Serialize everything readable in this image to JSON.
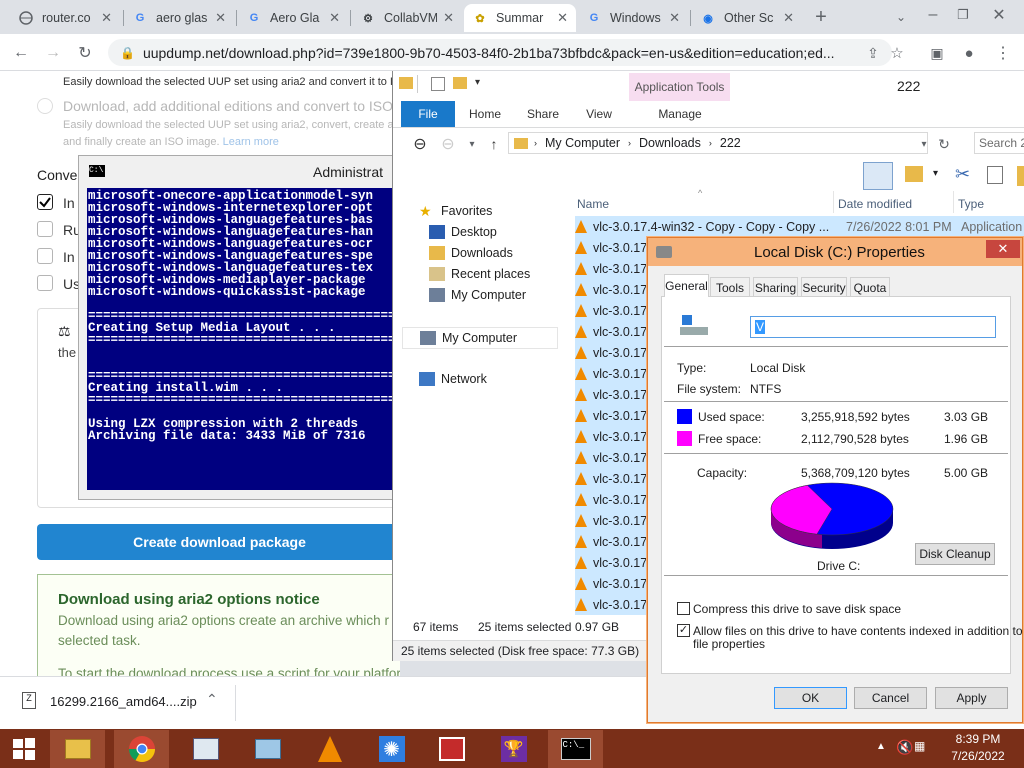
{
  "browser": {
    "tabs": [
      {
        "label": "router.co",
        "active": false
      },
      {
        "label": "aero glas",
        "active": false
      },
      {
        "label": "Aero Gla",
        "active": false
      },
      {
        "label": "CollabVM",
        "active": false
      },
      {
        "label": "Summar",
        "active": true
      },
      {
        "label": "Windows",
        "active": false
      },
      {
        "label": "Other Sc",
        "active": false
      }
    ],
    "url": "uupdump.net/download.php?id=739e1800-9b70-4503-84f0-2b1ba73bfbdc&pack=en-us&edition=education;ed..."
  },
  "page": {
    "line1": "Easily download the selected UUP set using aria2 and convert it to IS",
    "option_download_add": "Download, add additional editions and convert to ISO",
    "line2": "Easily download the selected UUP set using aria2, convert, create ad",
    "line3": "and finally create an ISO image.",
    "learn_more": "Learn more",
    "conv_heading": "Conver",
    "opt1": "In",
    "opt2": "Ru",
    "opt3": "In",
    "opt4": "Us",
    "box_text": "the",
    "create_button": "Create download package",
    "notice_title": "Download using aria2 options notice",
    "notice_line1": "Download using aria2 options create an archive which r",
    "notice_line2": "selected task.",
    "notice_line3": "To start the download process use a script for your platform:"
  },
  "cmd": {
    "title": "Administrat",
    "lines": [
      "microsoft-onecore-applicationmodel-syn",
      "microsoft-windows-internetexplorer-opt",
      "microsoft-windows-languagefeatures-bas",
      "microsoft-windows-languagefeatures-han",
      "microsoft-windows-languagefeatures-ocr",
      "microsoft-windows-languagefeatures-spe",
      "microsoft-windows-languagefeatures-tex",
      "microsoft-windows-mediaplayer-package",
      "microsoft-windows-quickassist-package",
      "",
      "===========================================",
      "Creating Setup Media Layout . . .",
      "===========================================",
      "",
      "",
      "===========================================",
      "Creating install.wim . . .",
      "===========================================",
      "",
      "Using LZX compression with 2 threads",
      "Archiving file data: 3433 MiB of 7316"
    ]
  },
  "download_bar": {
    "filename": "16299.2166_amd64....zip"
  },
  "explorer": {
    "window_title": "222",
    "contextual_tab": "Application Tools",
    "ribbon_tabs": [
      "File",
      "Home",
      "Share",
      "View",
      "Manage"
    ],
    "breadcrumb": [
      "My Computer",
      "Downloads",
      "222"
    ],
    "search_placeholder": "Search 2",
    "nav": {
      "favorites": "Favorites",
      "desktop": "Desktop",
      "downloads": "Downloads",
      "recent": "Recent places",
      "mycomputer_fav": "My Computer",
      "mycomputer": "My Computer",
      "network": "Network"
    },
    "columns": {
      "name": "Name",
      "date": "Date modified",
      "type": "Type"
    },
    "first_file": {
      "name": "vlc-3.0.17.4-win32 - Copy - Copy - Copy ...",
      "date": "7/26/2022 8:01 PM",
      "type": "Application"
    },
    "file_rows": [
      "vlc-3.0.17",
      "vlc-3.0.17",
      "vlc-3.0.17",
      "vlc-3.0.17",
      "vlc-3.0.17",
      "vlc-3.0.17",
      "vlc-3.0.17",
      "vlc-3.0.17",
      "vlc-3.0.17",
      "vlc-3.0.17",
      "vlc-3.0.17",
      "vlc-3.0.17",
      "vlc-3.0.17",
      "vlc-3.0.17",
      "vlc-3.0.17",
      "vlc-3.0.17",
      "vlc-3.0.17",
      "vlc-3.0.17"
    ],
    "item_count": "67 items",
    "selected_count": "25 items selected",
    "selected_size": "0.97 GB",
    "status_bar": "25 items selected (Disk free space: 77.3 GB)"
  },
  "props": {
    "title": "Local Disk (C:) Properties",
    "tabs": [
      "General",
      "Tools",
      "Sharing",
      "Security",
      "Quota"
    ],
    "name_value": "V",
    "type_label": "Type:",
    "type_value": "Local Disk",
    "fs_label": "File system:",
    "fs_value": "NTFS",
    "used_label": "Used space:",
    "used_bytes": "3,255,918,592 bytes",
    "used_gb": "3.03 GB",
    "free_label": "Free space:",
    "free_bytes": "2,112,790,528 bytes",
    "free_gb": "1.96 GB",
    "capacity_label": "Capacity:",
    "capacity_bytes": "5,368,709,120 bytes",
    "capacity_gb": "5.00 GB",
    "drive_label": "Drive C:",
    "cleanup_button": "Disk Cleanup",
    "compress_label": "Compress this drive to save disk space",
    "index_label_1": "Allow files on this drive to have contents indexed in addition to",
    "index_label_2": "file properties",
    "compress_checked": false,
    "index_checked": true,
    "ok": "OK",
    "cancel": "Cancel",
    "apply": "Apply",
    "used_color": "#0000ff",
    "free_color": "#ff00ff",
    "used_fraction": 0.606
  },
  "taskbar": {
    "time": "8:39 PM",
    "date": "7/26/2022"
  }
}
